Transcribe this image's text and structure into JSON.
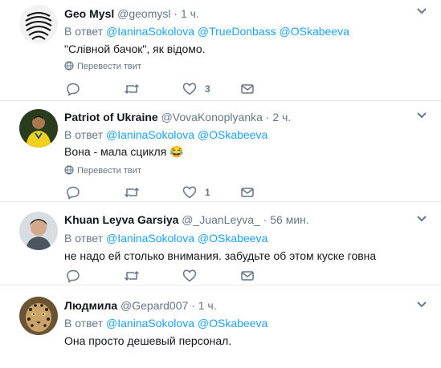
{
  "tweets": [
    {
      "name": "Geo Mysl",
      "handle": "@geomysl",
      "separator": "·",
      "time": "1 ч.",
      "reply_prefix": "В ответ",
      "mentions": [
        "@IaninaSokolova",
        "@TrueDonbass",
        "@OSkabeeva"
      ],
      "text": "\"Слівной бачок\", як відомо.",
      "translate": "Перевести твит",
      "like_count": "3",
      "reply_count": "",
      "retweet_count": ""
    },
    {
      "name": "Patriot of Ukraine",
      "handle": "@VovaKonoplyanka",
      "separator": "·",
      "time": "2 ч.",
      "reply_prefix": "В ответ",
      "mentions": [
        "@IaninaSokolova",
        "@OSkabeeva"
      ],
      "text": "Вона - мала сцикля 😂",
      "translate": "Перевести твит",
      "like_count": "1",
      "reply_count": "",
      "retweet_count": ""
    },
    {
      "name": "Khuan Leyva Garsiya",
      "handle": "@_JuanLeyva_",
      "separator": "·",
      "time": "56 мин.",
      "reply_prefix": "В ответ",
      "mentions": [
        "@IaninaSokolova",
        "@OSkabeeva"
      ],
      "text": "не надо ей столько внимания. забудьте об этом куске говна",
      "like_count": "",
      "reply_count": "",
      "retweet_count": ""
    },
    {
      "name": "Людмила",
      "handle": "@Gepard007",
      "separator": "·",
      "time": "1 ч.",
      "reply_prefix": "В ответ",
      "mentions": [
        "@IaninaSokolova",
        "@OSkabeeva"
      ],
      "text": "Она просто дешевый персонал."
    }
  ],
  "colors": {
    "link": "#1da1f2",
    "secondary": "#657786",
    "border": "#e6ecf0"
  }
}
